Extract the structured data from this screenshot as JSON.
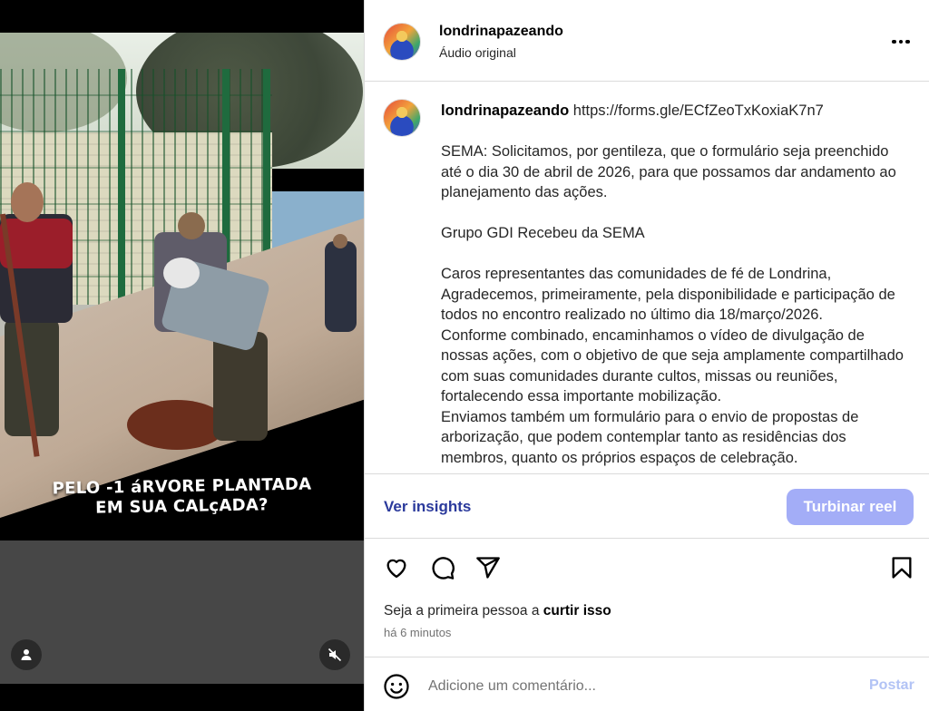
{
  "media": {
    "overlay_caption_line1": "PELO -1 áRVORE PLANTADA",
    "overlay_caption_line2": "EM SUA CALçADA?",
    "tag_icon": "user-icon",
    "mute_icon": "speaker-muted-icon"
  },
  "header": {
    "username": "londrinapazeando",
    "audio": "Áudio original",
    "more_icon": "more-horizontal-icon"
  },
  "post_caption": {
    "username": "londrinapazeando",
    "link": " https://forms.gle/ECfZeoTxKoxiaK7n7",
    "body": "\n\nSEMA: Solicitamos, por gentileza, que o formulário seja preenchido até o dia 30 de abril de 2026, para que possamos dar andamento ao planejamento das ações.\n\nGrupo GDI Recebeu da SEMA\n\nCaros representantes das comunidades de fé de Londrina,\nAgradecemos, primeiramente, pela disponibilidade e participação de todos no encontro realizado no último dia 18/março/2026.\nConforme combinado, encaminhamos o vídeo de divulgação de nossas ações, com o objetivo de que seja amplamente compartilhado com suas comunidades durante cultos, missas ou reuniões, fortalecendo essa importante mobilização.\nEnviamos também um formulário para o envio de propostas de arborização, que podem contemplar tanto as residências dos membros, quanto os próprios espaços de celebração."
  },
  "insights": {
    "link_label": "Ver insights",
    "boost_label": "Turbinar reel"
  },
  "actions": {
    "likes_prefix": "Seja a primeira pessoa a ",
    "likes_bold": "curtir isso",
    "time": "há 6 minutos"
  },
  "comment": {
    "placeholder": "Adicione um comentário...",
    "post_label": "Postar"
  },
  "colors": {
    "accent_link": "#2b3a9c",
    "boost_bg": "#a3adf7",
    "post_disabled": "#b2c3f5"
  }
}
